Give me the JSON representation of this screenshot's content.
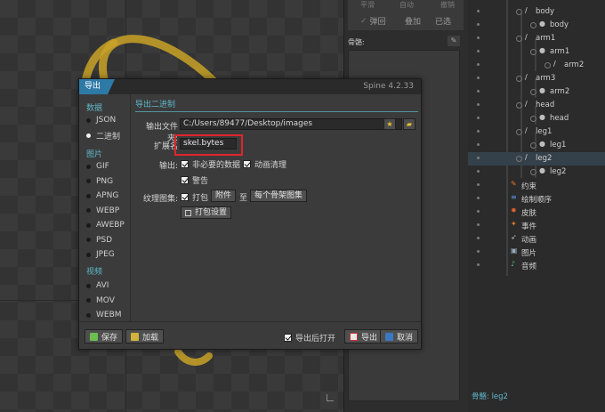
{
  "dialog": {
    "title": "导出",
    "version": "Spine 4.2.33",
    "categories": {
      "data": "数据",
      "image": "图片",
      "video": "视频"
    },
    "data_formats": [
      {
        "label": "JSON",
        "selected": false
      },
      {
        "label": "二进制",
        "selected": true
      }
    ],
    "image_formats": [
      "GIF",
      "PNG",
      "APNG",
      "WEBP",
      "AWEBP",
      "PSD",
      "JPEG"
    ],
    "video_formats": [
      "AVI",
      "MOV",
      "WEBM"
    ],
    "section_title": "导出二进制",
    "output_folder_label": "输出文件夹:",
    "output_folder_value": "C:/Users/89477/Desktop/images",
    "extension_label": "扩展名",
    "extension_value": "skel.bytes",
    "output_label": "输出:",
    "opt_nonessential": "非必要的数据",
    "opt_animation_cleanup": "动画清理",
    "opt_warnings": "警告",
    "atlas_label": "纹理图集:",
    "opt_pack": "打包",
    "pack_source": "附件",
    "pack_to": "至",
    "pack_target": "每个骨架图集",
    "pack_settings": "打包设置",
    "save": "保存",
    "load": "加载",
    "open_after": "导出后打开",
    "export": "导出",
    "cancel": "取消"
  },
  "middle_panel": {
    "top_labels": [
      "平滑",
      "自动",
      "撤销"
    ],
    "buttons": [
      "弹回",
      "叠加",
      "已选"
    ],
    "bones_title": "骨骼:"
  },
  "tree": {
    "items": [
      {
        "label": "body",
        "icon": "bone-icon"
      },
      {
        "label": "body",
        "icon": "slot-icon"
      },
      {
        "label": "arm1",
        "icon": "bone-icon"
      },
      {
        "label": "arm1",
        "icon": "slot-icon"
      },
      {
        "label": "arm2",
        "icon": "bone-icon"
      },
      {
        "label": "arm3",
        "icon": "bone-icon"
      },
      {
        "label": "arm2",
        "icon": "slot-icon"
      },
      {
        "label": "head",
        "icon": "bone-icon"
      },
      {
        "label": "head",
        "icon": "slot-icon"
      },
      {
        "label": "leg1",
        "icon": "bone-icon"
      },
      {
        "label": "leg1",
        "icon": "slot-icon"
      },
      {
        "label": "leg2",
        "icon": "bone-icon",
        "selected": true
      },
      {
        "label": "leg2",
        "icon": "slot-icon"
      },
      {
        "label": "约束",
        "icon": "constraint-icon"
      },
      {
        "label": "绘制顺序",
        "icon": "draw-order-icon"
      },
      {
        "label": "皮肤",
        "icon": "skin-icon"
      },
      {
        "label": "事件",
        "icon": "event-icon"
      },
      {
        "label": "动画",
        "icon": "animation-icon"
      },
      {
        "label": "图片",
        "icon": "images-icon"
      },
      {
        "label": "音频",
        "icon": "audio-icon"
      }
    ],
    "status": "骨骼: leg2"
  },
  "colors": {
    "accent": "#2e7aa7",
    "cyan_text": "#5fb7c9",
    "highlight_border": "#e0262b",
    "snake": "#c9a227"
  }
}
